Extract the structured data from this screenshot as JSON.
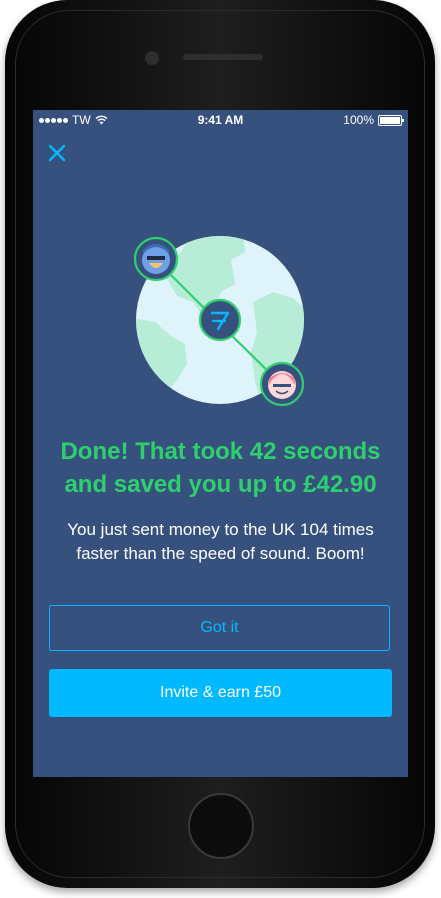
{
  "status_bar": {
    "carrier": "TW",
    "time": "9:41 AM",
    "battery_percent": "100%",
    "battery_level": 1.0
  },
  "icons": {
    "close": "close-icon",
    "logo": "transferwise-logo-icon",
    "sender_avatar": "sender-avatar-icon",
    "recipient_avatar": "recipient-avatar-icon"
  },
  "colors": {
    "background": "#37517e",
    "accent_green": "#2ed06e",
    "accent_blue": "#00b9ff",
    "globe_land": "#b7ecd6",
    "globe_water": "#dff3fb"
  },
  "success": {
    "headline_line1": "Done! That took 42 seconds",
    "headline_line2": "and saved you up to £42.90",
    "message_line1": "You just sent money to the UK 104 times",
    "message_line2": "faster than the speed of sound. Boom!"
  },
  "actions": {
    "got_it_label": "Got it",
    "invite_label": "Invite & earn £50"
  }
}
